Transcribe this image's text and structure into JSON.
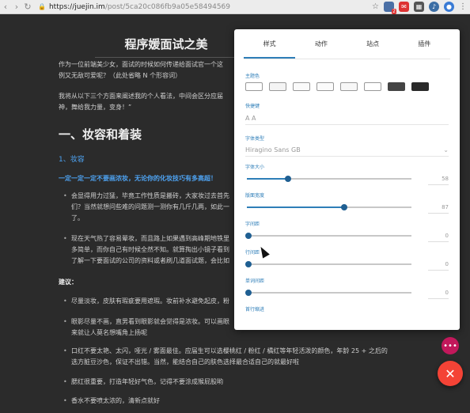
{
  "browser": {
    "url_host": "https://juejin.im",
    "url_path": "/post/5ca20c086fb9a05e58494569",
    "ext_badge": "2"
  },
  "article": {
    "title": "程序媛面试之美",
    "intro1": "作为一位前端美少女，面试的时候如何传递给面试官一个这",
    "intro2": "例又无敌可爱呢？（此处省略 N 个形容词）",
    "intro3": "我将从以下三个方面来阐述我的个人看法，中间会区分应届",
    "intro4": "神，舞给我力量，变身！”",
    "h1": "一、妆容和着装",
    "h3": "1、妆容",
    "highlight": "一定一定一定不要画浓妆，无论你的化妆技巧有多高超！",
    "b1_1": "会显得用力过猛，毕竟工作性质是搬砖，大家妆过去首先",
    "b1_2": "们？当然就想问些难的问题测一测你有几斤几两，如此一",
    "b1_3": "了。",
    "b2_1": "现在天气热了容易晕妆，而且路上如果遇到高峰期地铁里",
    "b2_2": "多简单，而你自己有时候全然不知。就算掏出小镜子看到",
    "b2_3": "了解一下要面试的公司的资料或者刷几道面试题，会比如",
    "suggest": "建议：",
    "s1": "尽量淡妆，皮肤有瑕疵要用遮瑕。妆前补水避免起皮，粉",
    "s2_1": "眼影尽量不画，直男看到眼影就会觉得是浓妆。可以画眼",
    "s2_2": "来就让人莫名想嘴角上扬呢",
    "s3_1": "口红不要太艳、太闪，哑光 / 雾面最佳。应届生可以选樱桃红 / 粉红 / 橘红等年轻活泼的颜色，年龄 25 + 之后的",
    "s3_2": "选方脏豆沙色，保证不出错。当然，能结合自己的肤色选择最合适自己的就最好啦",
    "s4": "腮红很重要，打造年轻好气色，记得不要涂成猴屁股哟",
    "s5": "香水不要喷太浓的，清新点就好"
  },
  "panel": {
    "tabs": [
      "样式",
      "动作",
      "站点",
      "插件"
    ],
    "active_tab": 0,
    "theme_label": "主题色",
    "shortcut_label": "快捷键",
    "shortcut_value": "A A",
    "font_type_label": "字体类型",
    "font_type_value": "Hiragino Sans GB",
    "font_size_label": "字体大小",
    "font_size_value": "58",
    "layout_width_label": "版面宽度",
    "layout_width_value": "87",
    "letter_spacing_label": "字间距",
    "letter_spacing_value": "0",
    "line_spacing_label": "行间距",
    "line_spacing_value": "0",
    "word_spacing_label": "单词间距",
    "word_spacing_value": "0",
    "indent_label": "首行缩进"
  },
  "sliders": {
    "font_size": 0.24,
    "layout_width": 0.58,
    "letter_spacing": 0,
    "line_spacing": 0,
    "word_spacing": 0
  },
  "colors": {
    "accent": "#2e7eb8",
    "fab": "#f44336",
    "fab_small": "#c2185b"
  },
  "icons": {
    "fab_small": "more-icon",
    "fab": "close-icon"
  }
}
